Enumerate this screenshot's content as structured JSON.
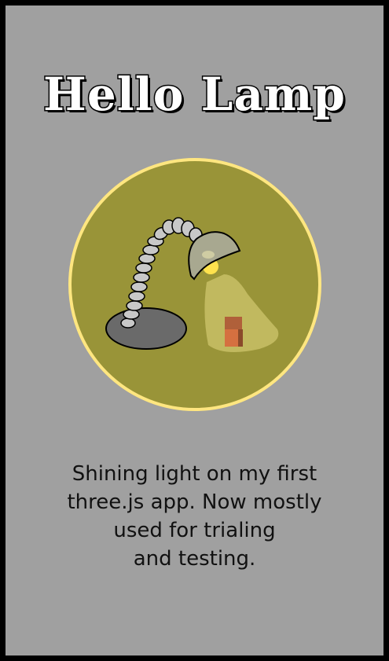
{
  "card": {
    "title": "Hello Lamp",
    "description_lines": [
      "Shining light on my first",
      "three.js app. Now mostly",
      "used for trialing",
      "and testing."
    ]
  },
  "colors": {
    "page_border": "#000000",
    "card_background": "#a0a0a0",
    "circle_fill": "#999438",
    "circle_border": "#ffe680",
    "lamp_base": "#6a6a6a",
    "lamp_segments": "#c8c8c8",
    "lamp_shade": "#a8a890",
    "bulb": "#ffe24d",
    "light_cone": "#c8c066",
    "box": "#c86a3c"
  },
  "icons": {
    "illustration": "desk-lamp-illustration"
  }
}
